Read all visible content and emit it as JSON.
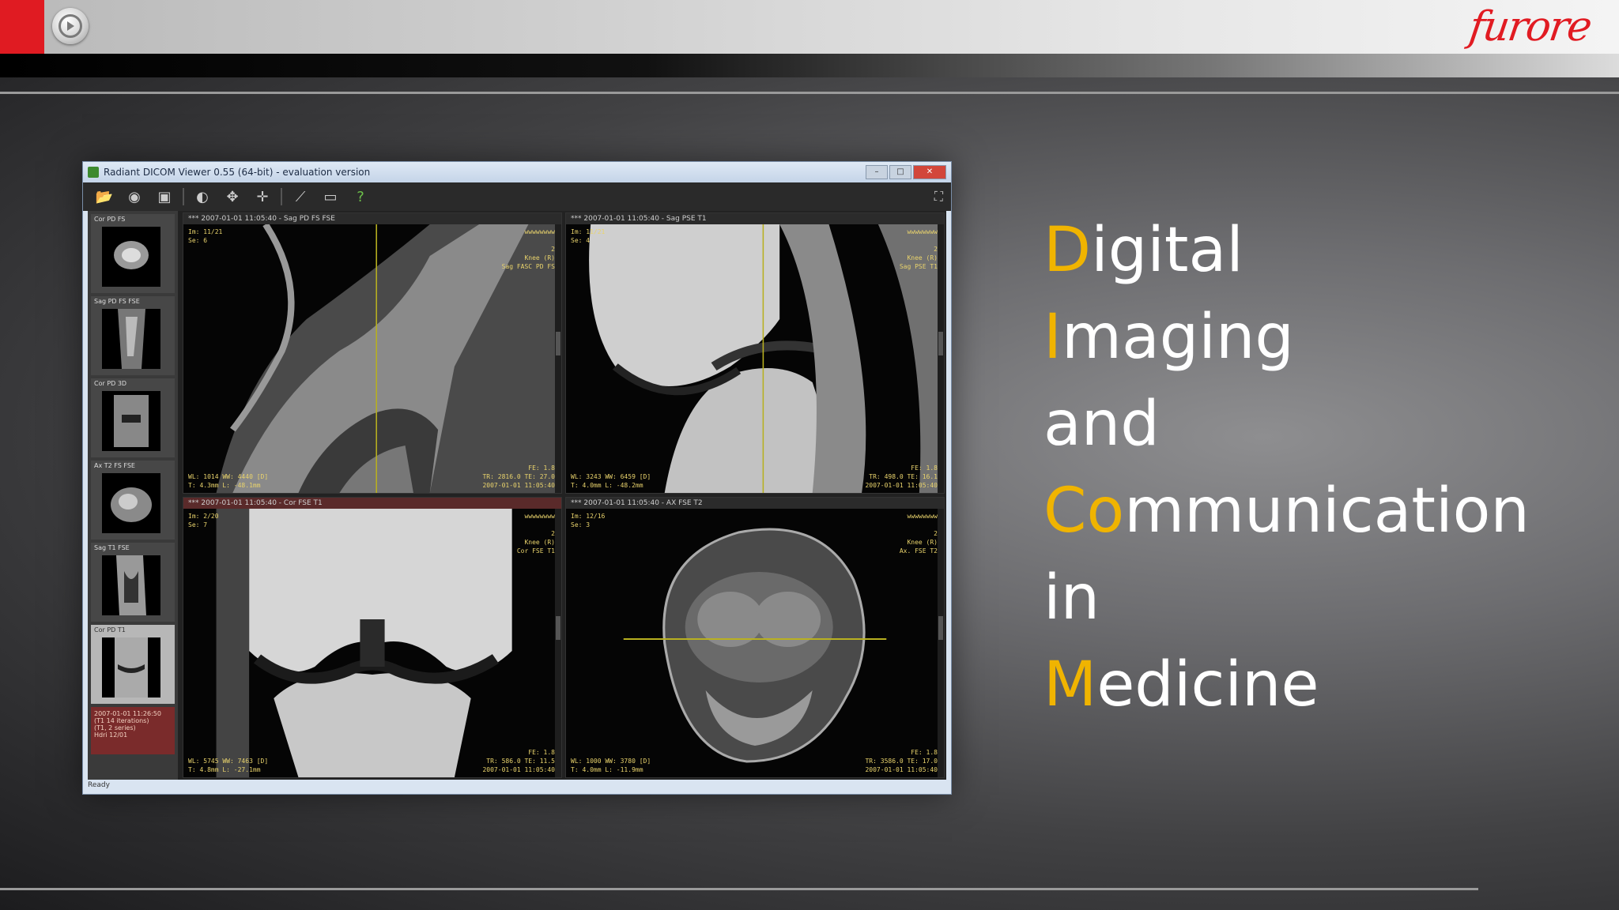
{
  "brand": {
    "logo_text": "furore",
    "accent_color": "#e01b22"
  },
  "window": {
    "title": "Radiant DICOM Viewer 0.55 (64-bit) - evaluation version",
    "controls": [
      "–",
      "□",
      "✕"
    ],
    "status": "Ready"
  },
  "toolbar": {
    "tools": [
      "folder-open-icon",
      "database-icon",
      "save-icon",
      "window-level-icon",
      "pan-icon",
      "crosshair-icon",
      "measure-icon",
      "screenshot-icon",
      "help-icon"
    ]
  },
  "thumbnails": [
    {
      "label": "Cor PD FS"
    },
    {
      "label": "Sag PD FS FSE"
    },
    {
      "label": "Cor PD 3D"
    },
    {
      "label": "Ax T2 FS FSE"
    },
    {
      "label": "Sag T1 FSE"
    },
    {
      "label": "Cor PD T1",
      "active": true
    }
  ],
  "series_info": [
    "2007-01-01 11:26:50",
    "(T1 14 iterations)",
    "(T1, 2 series)",
    "Hdri 12/01"
  ],
  "panes": [
    {
      "header": "*** 2007-01-01 11:05:40 - Sag PD FS FSE",
      "tl": "Im: 11/21\nSe: 6",
      "tr": "wwwwwwww\n\n2\nKnee (R)\nSag FASC PD FS",
      "bl": "WL: 1014 WW: 4440 [D]\nT: 4.3mm L: -48.1mm",
      "br": "FE: 1.8\nTR: 2816.0 TE: 27.0\n2007-01-01 11:05:40"
    },
    {
      "header": "*** 2007-01-01 11:05:40 - Sag PSE T1",
      "tl": "Im: 11/21\nSe: 4",
      "tr": "wwwwwwww\n\n2\nKnee (R)\nSag PSE T1",
      "bl": "WL: 3243 WW: 6459 [D]\nT: 4.0mm L: -48.2mm",
      "br": "FE: 1.8\nTR: 498.0 TE: 16.1\n2007-01-01 11:05:40"
    },
    {
      "header": "*** 2007-01-01 11:05:40 - Cor FSE T1",
      "tl": "Im: 2/20\nSe: 7",
      "tr": "wwwwwwww\n\n2\nKnee (R)\nCor FSE T1",
      "bl": "WL: 5745 WW: 7463 [D]\nT: 4.8mm L: -27.1mm",
      "br": "FE: 1.8\nTR: 586.0 TE: 11.5\n2007-01-01 11:05:40"
    },
    {
      "header": "*** 2007-01-01 11:05:40 - AX FSE T2",
      "tl": "Im: 12/16\nSe: 3",
      "tr": "wwwwwwww\n\n2\nKnee (R)\nAx. FSE T2",
      "bl": "WL: 1000 WW: 3780 [D]\nT: 4.0mm L: -11.9mm",
      "br": "FE: 1.8\nTR: 3586.0 TE: 17.0\n2007-01-01 11:05:40"
    }
  ],
  "headline": [
    {
      "accent": "D",
      "rest": "igital"
    },
    {
      "accent": "I",
      "rest": "maging"
    },
    {
      "accent": "",
      "rest": "and"
    },
    {
      "accent": "Co",
      "rest": "mmunication"
    },
    {
      "accent": "",
      "rest": "in"
    },
    {
      "accent": "M",
      "rest": "edicine"
    }
  ],
  "accent_text_color": "#f0b400"
}
